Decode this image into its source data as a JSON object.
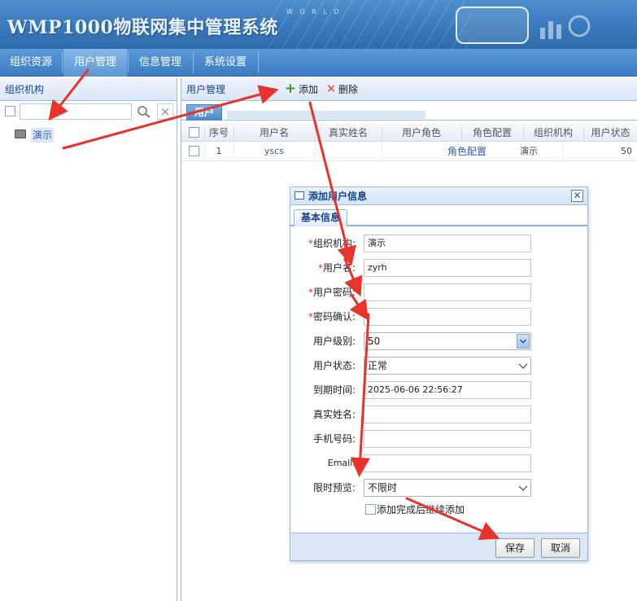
{
  "app": {
    "title": "WMP1000物联网集中管理系统",
    "header_decoration_text": "W O R L D"
  },
  "nav": {
    "items": [
      {
        "label": "组织资源",
        "active": false
      },
      {
        "label": "用户管理",
        "active": true
      },
      {
        "label": "信息管理",
        "active": false
      },
      {
        "label": "系统设置",
        "active": false
      }
    ]
  },
  "left_panel": {
    "title": "组织机构",
    "search": {
      "value": "",
      "placeholder": ""
    },
    "tree": [
      {
        "label": "演示",
        "icon": "monitor-icon"
      }
    ]
  },
  "right_panel": {
    "title": "用户管理",
    "toolbar": {
      "add_label": "添加",
      "delete_label": "删除"
    },
    "tab": "用户",
    "columns": [
      "序号",
      "用户名",
      "真实姓名",
      "用户角色",
      "角色配置",
      "组织机构",
      "用户状态"
    ],
    "rows": [
      {
        "index": "1",
        "username": "yscs",
        "real_name": "",
        "role": "",
        "role_config": "角色配置",
        "org": "演示",
        "status": "50"
      }
    ]
  },
  "dialog": {
    "title": "添加用户信息",
    "tab": "基本信息",
    "fields": {
      "org": {
        "label": "组织机构:",
        "required": true,
        "value": "演示"
      },
      "username": {
        "label": "用户名:",
        "required": true,
        "value": "zyrh"
      },
      "password": {
        "label": "用户密码:",
        "required": true,
        "value": ""
      },
      "password_confirm": {
        "label": "密码确认:",
        "required": true,
        "value": ""
      },
      "level": {
        "label": "用户级别:",
        "value": "50"
      },
      "status": {
        "label": "用户状态:",
        "value": "正常"
      },
      "expire": {
        "label": "到期时间:",
        "value": "2025-06-06 22:56:27"
      },
      "real_name": {
        "label": "真实姓名:",
        "value": ""
      },
      "phone": {
        "label": "手机号码:",
        "value": ""
      },
      "email": {
        "label": "Email:",
        "value": ""
      },
      "preview_limit": {
        "label": "限时预览:",
        "value": "不限时"
      }
    },
    "required_mark": "*",
    "keep_adding_label": "添加完成后继续添加",
    "save_label": "保存",
    "cancel_label": "取消"
  },
  "colors": {
    "header_blue": "#3a79bd",
    "panel_border": "#99bbe8",
    "panel_title": "#15428b",
    "annotation_arrow": "#e8332a"
  }
}
